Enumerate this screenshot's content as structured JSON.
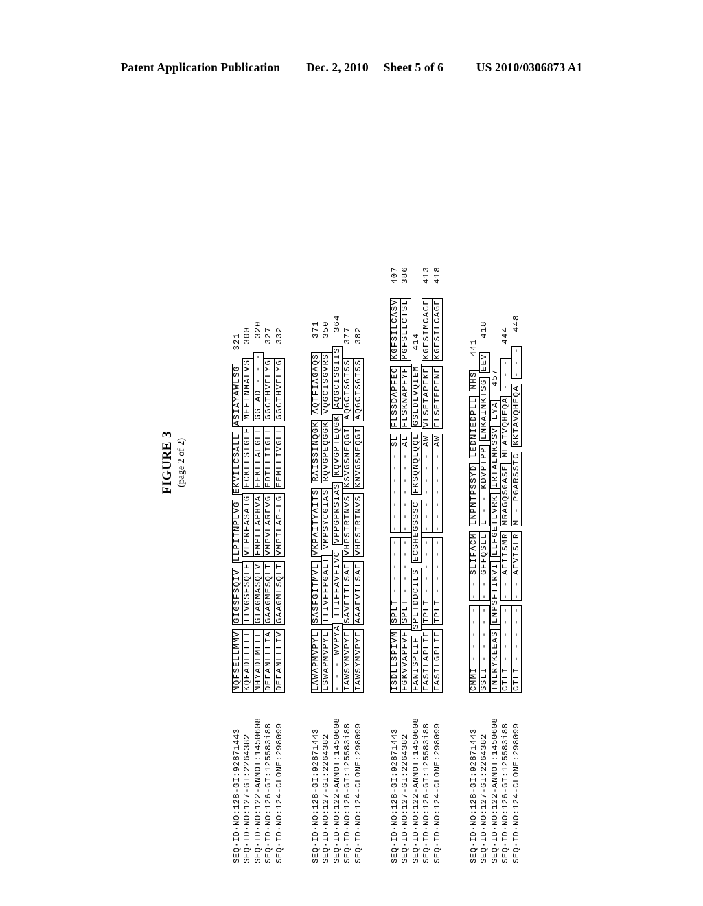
{
  "header": {
    "publication": "Patent Application Publication",
    "date": "Dec. 2, 2010",
    "sheet": "Sheet 5 of 6",
    "patent_number": "US 2010/0306873 A1"
  },
  "figure": {
    "title": "FIGURE 3",
    "subtitle": "(page 2 of 2)"
  },
  "alignment": {
    "labels": [
      "SEQ·ID·NO:128-GI:9287i443",
      "SEQ·ID·NO:127-GI:2264382",
      "SEQ·ID·NO:122-ANNOT:1450608",
      "SEQ·ID·NO:126-GI:125583i88",
      "SEQ·ID·NO:124-CLONE:298099"
    ],
    "blocks": [
      {
        "rows": [
          {
            "segments": [
              "NQFSELLMMV",
              "GIGSFSQIV",
              "LLPITNPLVG",
              "EKVILCSALL",
              "ASIAYAWLSG"
            ],
            "number": "321"
          },
          {
            "segments": [
              "KQFADLLLLI",
              "TIVGSFSQLF",
              "VLPRFASAIG",
              "ECKLLSTGLF",
              "MEFINMALVS"
            ],
            "number": "300"
          },
          {
            "segments": [
              "NHYADLMLLL",
              "GIAGMASQLV",
              "FMPLLAPHVA",
              "EEKLLALGLL",
              "GG AD - - -"
            ],
            "number": "320"
          },
          {
            "segments": [
              "DEFANLLLIA",
              "GAAGMESQLT",
              "VMPVLARFVG",
              "EDTLLIIGLL",
              "GGCTHVFLYG"
            ],
            "number": "327"
          },
          {
            "segments": [
              "DEFANLLLIV",
              "GAAGMLSQLT",
              "VMPILAP-LG",
              "EEMLLIVGLL",
              "GGCTHVFLYG"
            ],
            "number": "332"
          }
        ]
      },
      {
        "rows": [
          {
            "segments": [
              "LAWAPMVPYL",
              "SASFGITMVL",
              "VKPAITYAITS",
              "RAISSINQGK",
              "AQTFIAGAQS"
            ],
            "number": "371"
          },
          {
            "segments": [
              "LSWAPMVPYL",
              "TTIVFFPGALT",
              "VMPSYCGIAS",
              "RQVGPEQGGK",
              "VQGCISGVRS"
            ],
            "number": "350"
          },
          {
            "segments": [
              "- - - WVPYA",
              "TTIFFAVFIVC",
              "VPPGPRSIAS",
              "KQVGPTEQGK",
              "AQGCISGIIS"
            ],
            "number": "364"
          },
          {
            "segments": [
              "IAWSYMVPYF",
              "SAVFITLSAF",
              "VHPSIRTNVS",
              "KSVGSNEQGI",
              "AQGCISGISS"
            ],
            "number": "377"
          },
          {
            "segments": [
              "IAWSYMVPYF",
              "AAAFVILSAF",
              "VHPSIRTNVS",
              "KNVGSNEQGI",
              "AQGCISGISS"
            ],
            "number": "382"
          }
        ]
      },
      {
        "rows": [
          {
            "segments": [
              "ISDLLSPIVM",
              "SPLT - - - - -",
              "- - - - - - - SL",
              "FLSSDAPFEC",
              "KGFSILCASV"
            ],
            "number": "407"
          },
          {
            "segments": [
              "FGKVVAPFVF",
              "SPLT - - - - -",
              "- - - - - - - AL",
              "FLSKNAPFYF",
              "PGFSLLCTSL"
            ],
            "number": "386"
          },
          {
            "segments": [
              "FANISPLIF",
              "SPLTDDCILS",
              "ECSHEGSSSC",
              "FKSQNQLQQL",
              "GSLDLVQIEM"
            ],
            "number": "414"
          },
          {
            "segments": [
              "FASILAPLIF",
              "TPLT - - - - -",
              "- - - - - - - AW",
              "VLSETAPFKF",
              "KGFSIMCACF"
            ],
            "number": "413"
          },
          {
            "segments": [
              "FASILGPLIF",
              "TPLT - - - - -",
              "- - - - - - - AW",
              "FLSETEPFNF",
              "KGFSILCAGF"
            ],
            "number": "418"
          }
        ]
      },
      {
        "rows": [
          {
            "segments": [
              "CMMI - - - - -",
              "- - SLIFACM",
              "LNPNTPSSYD",
              "LEDNIEDPLL",
              "NHS"
            ],
            "number": "441"
          },
          {
            "segments": [
              "SSLI - - - - -",
              "- - GFFQSLL",
              "L - - KDVPTPP",
              "LNKAINKTSG",
              "EEV"
            ],
            "number": "418"
          },
          {
            "segments": [
              "TNLRYKEEAS",
              "LNPSFTIRVI",
              "LLFGETLVRK",
              "IRTALMKSSV",
              "LYA"
            ],
            "number": "457"
          },
          {
            "segments": [
              "CTLI - - - - -",
              "- - AFIISMR",
              "MRAGQSGASE",
              "MLAIVQHEQA",
              "- - -"
            ],
            "number": "444"
          },
          {
            "segments": [
              "CTLI - - - - -",
              "- - AFVISLR",
              "M - PGARSSTC",
              "KKTAVQHEQA",
              "- - -"
            ],
            "number": "448"
          }
        ]
      }
    ]
  }
}
